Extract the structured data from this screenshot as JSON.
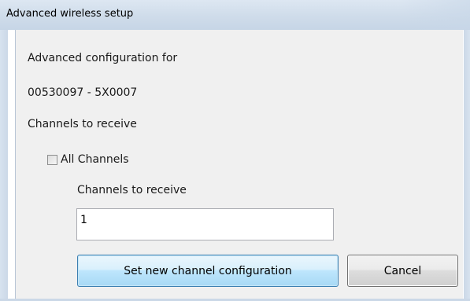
{
  "window": {
    "title": "Advanced wireless setup"
  },
  "dialog": {
    "heading": "Advanced configuration for",
    "device_id": "00530097 - 5X0007",
    "section_label": "Channels to receive",
    "all_channels": {
      "label": "All Channels",
      "checked": false
    },
    "channels_field": {
      "label": "Channels to receive",
      "value": "1"
    },
    "buttons": {
      "set_label": "Set new channel configuration",
      "cancel_label": "Cancel"
    }
  }
}
